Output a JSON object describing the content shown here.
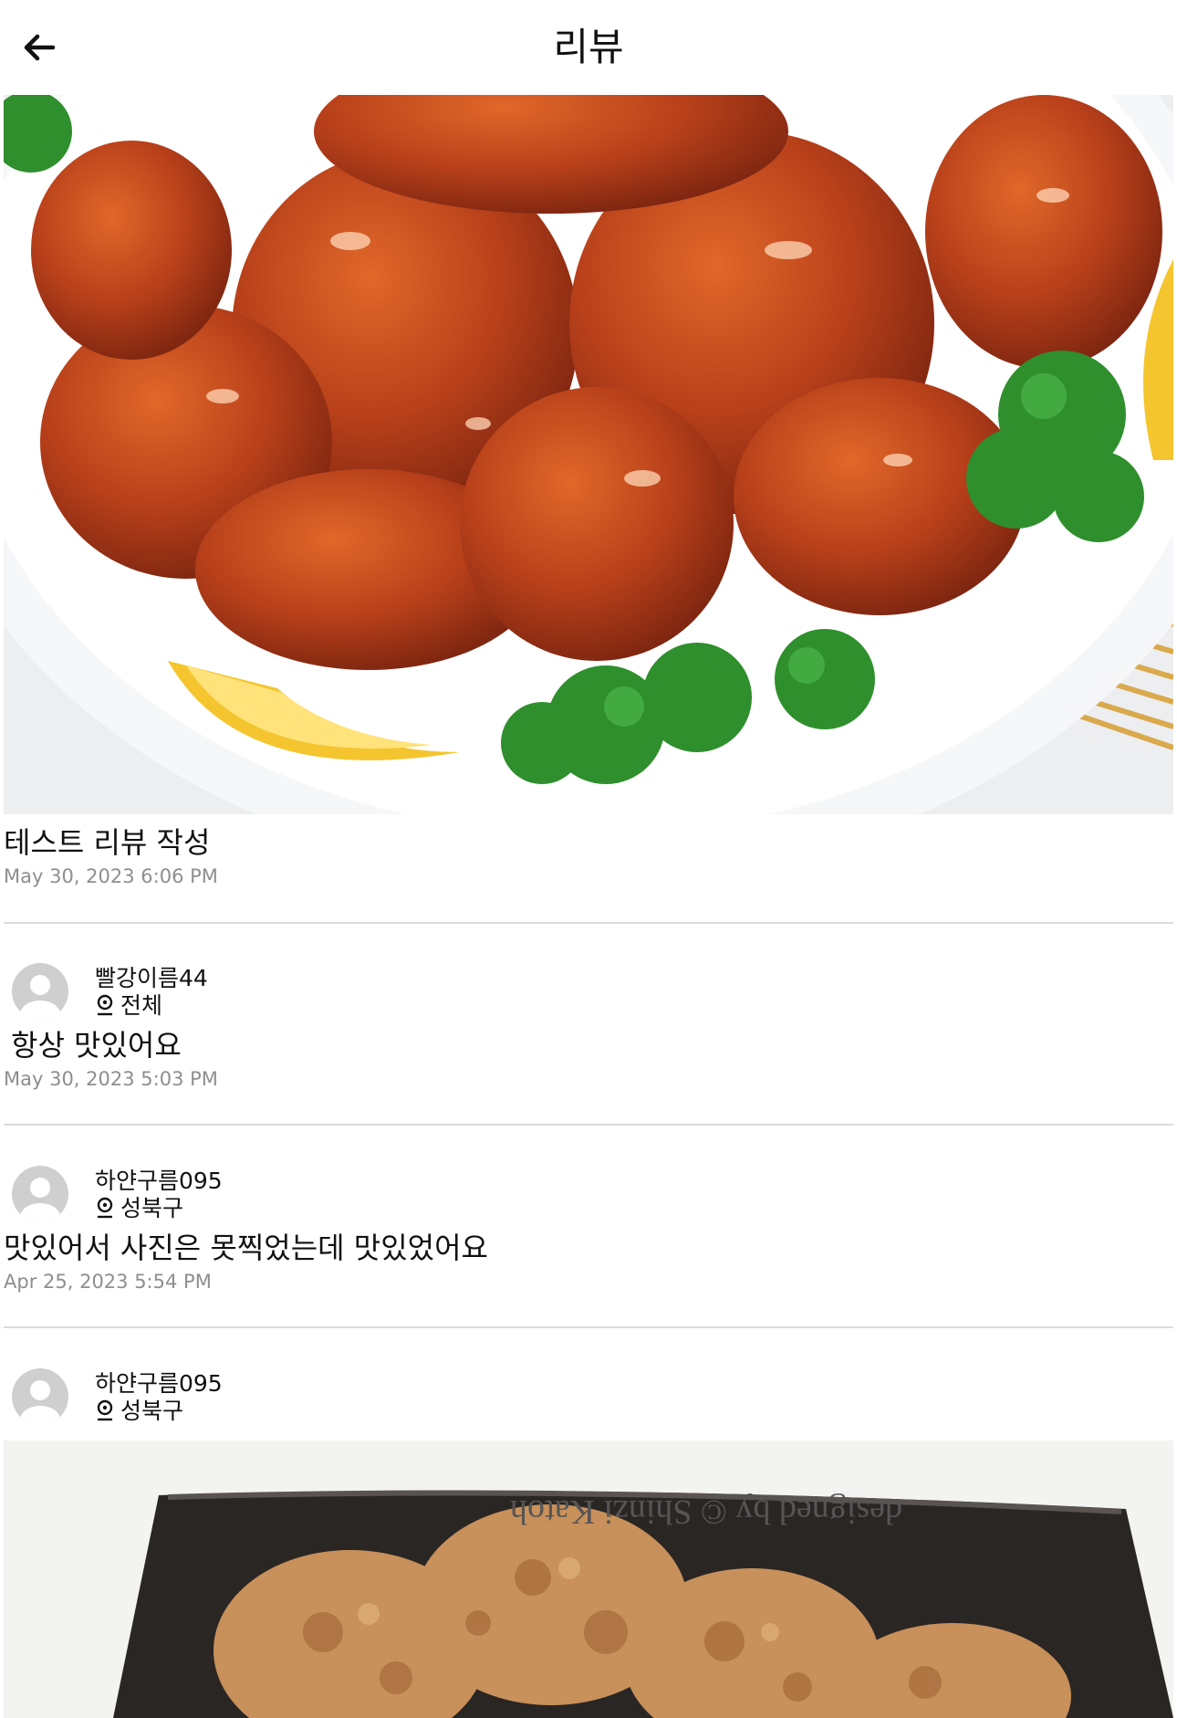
{
  "header": {
    "title": "리뷰",
    "back_icon": "arrow-left-icon"
  },
  "main_review": {
    "title": "테스트 리뷰 작성",
    "timestamp": "May 30, 2023 6:06 PM"
  },
  "comments": [
    {
      "username": "빨강이름44",
      "location": "전체",
      "text": "항상 맛있어요",
      "timestamp": "May 30, 2023 5:03 PM"
    },
    {
      "username": "하얀구름095",
      "location": "성북구",
      "text": "맛있어서 사진은 못찍었는데 맛있었어요",
      "timestamp": "Apr 25, 2023 5:54 PM"
    },
    {
      "username": "하얀구름095",
      "location": "성북구",
      "photo_watermark": "designed by © Shinzi Katoh"
    }
  ],
  "colors": {
    "divider": "#dcdcdc",
    "timestamp": "#8e8e8e",
    "avatar": "#cfcfcf"
  }
}
